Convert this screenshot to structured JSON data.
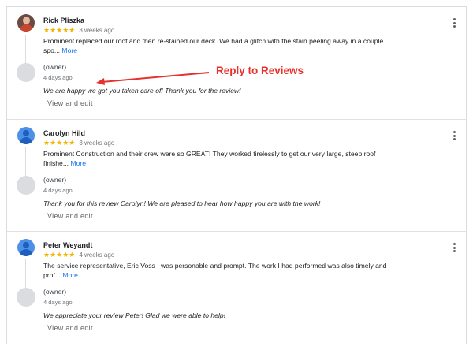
{
  "annotation": {
    "label": "Reply to Reviews",
    "color": "#e8302c"
  },
  "reviews": [
    {
      "author": "Rick Pliszka",
      "stars": "★★★★★",
      "rating": 5,
      "time": "3 weeks ago",
      "text_line1": "Prominent replaced our roof and then re-stained our deck. We had a glitch with the stain peeling away in a couple",
      "text_line2": "spo...",
      "more_label": "More",
      "owner_label": "(owner)",
      "owner_time": "4 days ago",
      "reply": "We are happy we got you taken care of! Thank you for the review!",
      "edit_label": "View and edit"
    },
    {
      "author": "Carolyn Hild",
      "stars": "★★★★★",
      "rating": 5,
      "time": "3 weeks ago",
      "text_line1": "Prominent Construction and their crew were so GREAT! They worked tirelessly to get our very large, steep roof",
      "text_line2": "finishe...",
      "more_label": "More",
      "owner_label": "(owner)",
      "owner_time": "4 days ago",
      "reply": "Thank you for this review Carolyn! We are pleased to hear how happy you are with the work!",
      "edit_label": "View and edit"
    },
    {
      "author": "Peter Weyandt",
      "stars": "★★★★★",
      "rating": 5,
      "time": "4 weeks ago",
      "text_line1": "The service representative, Eric Voss , was personable and prompt. The work I had performed was also timely and",
      "text_line2": "prof...",
      "more_label": "More",
      "owner_label": "(owner)",
      "owner_time": "4 days ago",
      "reply": "We appreciate your review Peter! Glad we were able to help!",
      "edit_label": "View and edit"
    }
  ],
  "colors": {
    "star": "#f4b400",
    "link": "#1a73e8",
    "generic_avatar": "#4d90e8"
  }
}
